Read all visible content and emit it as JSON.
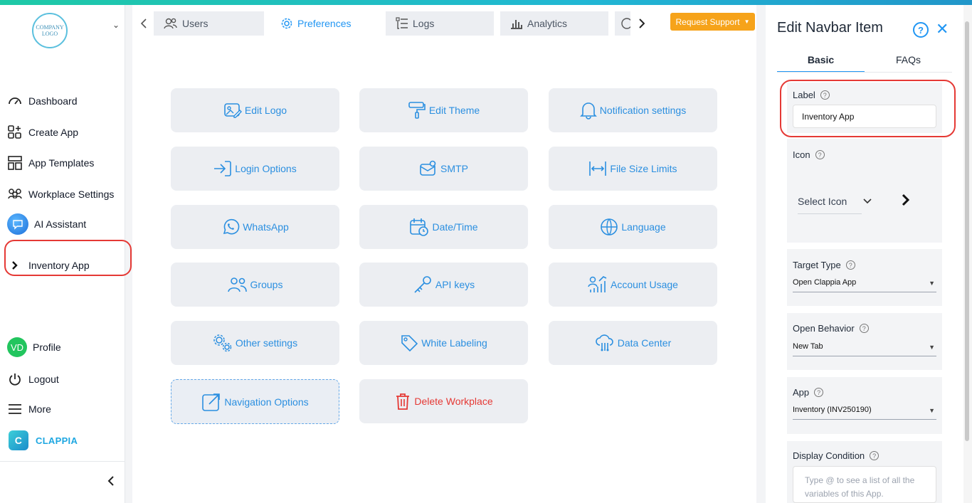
{
  "sidebar": {
    "logo_text": "COMPANY LOGO",
    "items": [
      {
        "label": "Dashboard",
        "icon": "gauge-icon"
      },
      {
        "label": "Create App",
        "icon": "add-app-icon"
      },
      {
        "label": "App Templates",
        "icon": "templates-icon"
      },
      {
        "label": "Workplace Settings",
        "icon": "users-settings-icon"
      },
      {
        "label": "AI Assistant",
        "icon": "ai-chat-icon"
      },
      {
        "label": "Inventory App",
        "icon": "chevron-right-icon"
      }
    ],
    "profile": {
      "initials": "VD",
      "label": "Profile"
    },
    "logout_label": "Logout",
    "more_label": "More",
    "brand": "CLAPPIA"
  },
  "tabs": [
    {
      "label": "Users",
      "icon": "users-icon"
    },
    {
      "label": "Preferences",
      "icon": "gear-icon"
    },
    {
      "label": "Logs",
      "icon": "logs-icon"
    },
    {
      "label": "Analytics",
      "icon": "bar-chart-icon"
    }
  ],
  "request_support_label": "Request Support",
  "cards": [
    {
      "label": "Edit Logo"
    },
    {
      "label": "Edit Theme"
    },
    {
      "label": "Notification settings"
    },
    {
      "label": "Login Options"
    },
    {
      "label": "SMTP"
    },
    {
      "label": "File Size Limits"
    },
    {
      "label": "WhatsApp"
    },
    {
      "label": "Date/Time"
    },
    {
      "label": "Language"
    },
    {
      "label": "Groups"
    },
    {
      "label": "API keys"
    },
    {
      "label": "Account Usage"
    },
    {
      "label": "Other settings"
    },
    {
      "label": "White Labeling"
    },
    {
      "label": "Data Center"
    },
    {
      "label": "Navigation Options"
    },
    {
      "label": "Delete Workplace"
    }
  ],
  "panel": {
    "title": "Edit Navbar Item",
    "tabs": [
      "Basic",
      "FAQs"
    ],
    "label_field": {
      "label": "Label",
      "value": "Inventory App"
    },
    "icon_field": {
      "label": "Icon",
      "select_label": "Select Icon"
    },
    "target_type": {
      "label": "Target Type",
      "value": "Open Clappia App"
    },
    "open_behavior": {
      "label": "Open Behavior",
      "value": "New Tab"
    },
    "app": {
      "label": "App",
      "value": "Inventory (INV250190)"
    },
    "display_condition": {
      "label": "Display Condition",
      "placeholder": "Type @ to see a list of all the variables of this App."
    }
  },
  "colors": {
    "accent": "#2196f3",
    "danger": "#e53935",
    "warning": "#f6a31a",
    "card_bg": "#eceef2"
  }
}
